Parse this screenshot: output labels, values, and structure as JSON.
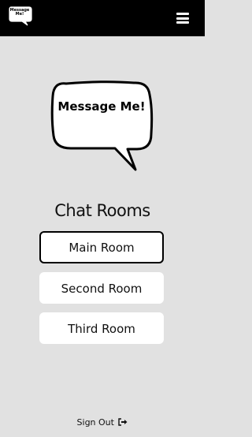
{
  "navbar": {
    "logo_text": "Message Me!",
    "menu_icon": "hamburger-menu-icon"
  },
  "hero": {
    "logo_text": "Message Me!"
  },
  "rooms": {
    "title": "Chat Rooms",
    "items": [
      {
        "label": "Main Room",
        "active": true
      },
      {
        "label": "Second Room",
        "active": false
      },
      {
        "label": "Third Room",
        "active": false
      }
    ]
  },
  "footer": {
    "sign_out_label": "Sign Out",
    "sign_out_icon": "sign-out-icon"
  },
  "colors": {
    "navbar_bg": "#000000",
    "page_bg": "#e1e1e1",
    "button_bg": "#ffffff",
    "text": "#111111"
  }
}
